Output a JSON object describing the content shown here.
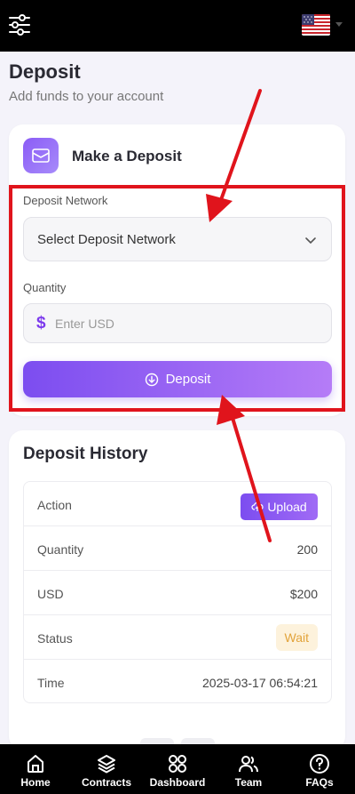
{
  "page": {
    "title": "Deposit",
    "subtitle": "Add funds to your account"
  },
  "deposit_card": {
    "title": "Make a Deposit",
    "network_label": "Deposit Network",
    "network_select_value": "Select Deposit Network",
    "quantity_label": "Quantity",
    "currency_symbol": "$",
    "quantity_placeholder": "Enter USD",
    "deposit_button": "Deposit"
  },
  "history": {
    "title": "Deposit History",
    "rows": [
      {
        "label": "Action",
        "value": "Upload"
      },
      {
        "label": "Quantity",
        "value": "200"
      },
      {
        "label": "USD",
        "value": "$200"
      },
      {
        "label": "Status",
        "value": "Wait"
      },
      {
        "label": "Time",
        "value": "2025-03-17 06:54:21"
      }
    ]
  },
  "nav": {
    "items": [
      {
        "label": "Home",
        "icon": "home-icon"
      },
      {
        "label": "Contracts",
        "icon": "layers-icon"
      },
      {
        "label": "Dashboard",
        "icon": "grid-icon"
      },
      {
        "label": "Team",
        "icon": "users-icon"
      },
      {
        "label": "FAQs",
        "icon": "question-icon"
      }
    ]
  },
  "colors": {
    "accent": "#7c4df0",
    "highlight": "#e0141c",
    "status_wait": "#e2a33a"
  },
  "icons": {
    "top_left": "filter-sliders-icon",
    "top_right": "us-flag-icon"
  }
}
